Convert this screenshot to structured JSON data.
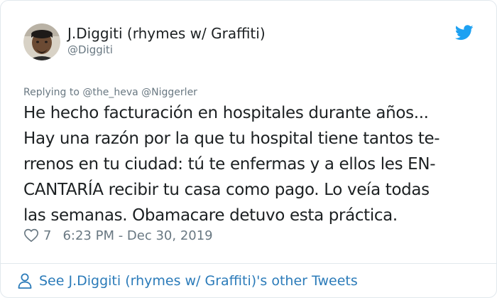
{
  "author": {
    "name": "J.Diggiti (rhymes w/ Graffiti)",
    "handle": "@Diggiti"
  },
  "reply": {
    "prefix": "Replying to",
    "handles": [
      "@the_heva",
      "@Niggerler"
    ]
  },
  "tweet": {
    "lines": [
      "He hecho facturación en hospitales durante años...",
      "Hay una razón por la que tu hospital tiene tantos te-",
      "rrenos en tu ciudad: tú te enfermas y a ellos les EN-",
      "CANTARÍA recibir tu casa como pago. Lo veía todas",
      "las semanas. Obamacare detuvo esta práctica."
    ]
  },
  "meta": {
    "likes": "7",
    "timestamp": "6:23 PM - Dec 30, 2019"
  },
  "footer": {
    "link_text": "See J.Diggiti (rhymes w/ Graffiti)'s other Tweets"
  },
  "colors": {
    "twitter_blue": "#1da1f2",
    "link_blue": "#2b7bb9",
    "muted_text": "#697882",
    "border": "#e1e8ed"
  },
  "icons": {
    "brand": "twitter-bird-icon",
    "like": "heart-icon",
    "profile": "person-icon"
  }
}
